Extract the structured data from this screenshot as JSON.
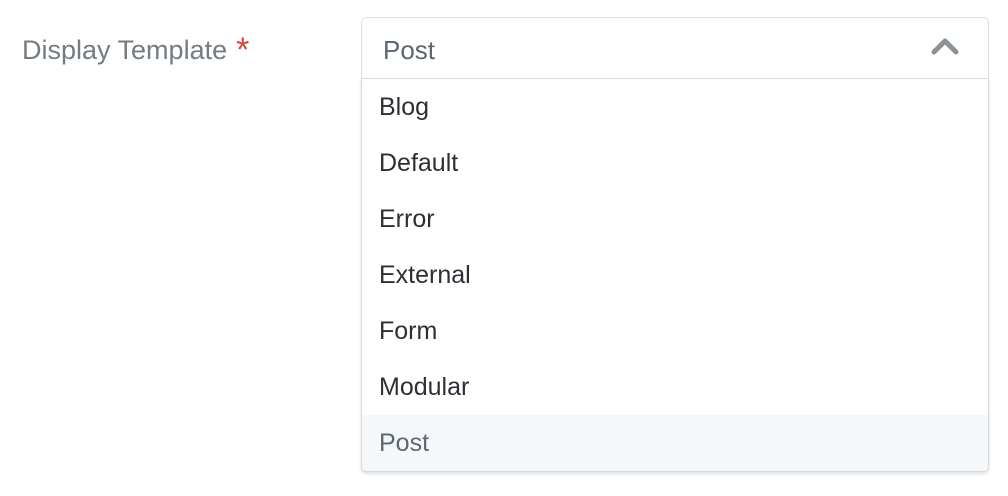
{
  "field": {
    "label": "Display Template",
    "required_mark": "*",
    "selected_value": "Post"
  },
  "dropdown": {
    "options": [
      {
        "label": "Blog"
      },
      {
        "label": "Default"
      },
      {
        "label": "Error"
      },
      {
        "label": "External"
      },
      {
        "label": "Form"
      },
      {
        "label": "Modular"
      },
      {
        "label": "Post"
      }
    ],
    "highlighted_option": "Post"
  },
  "icons": {
    "toggle": "chevron-up-icon"
  },
  "colors": {
    "label_text": "#737c85",
    "required_mark": "#d0453c",
    "highlight_background": "#f4f8fb"
  }
}
